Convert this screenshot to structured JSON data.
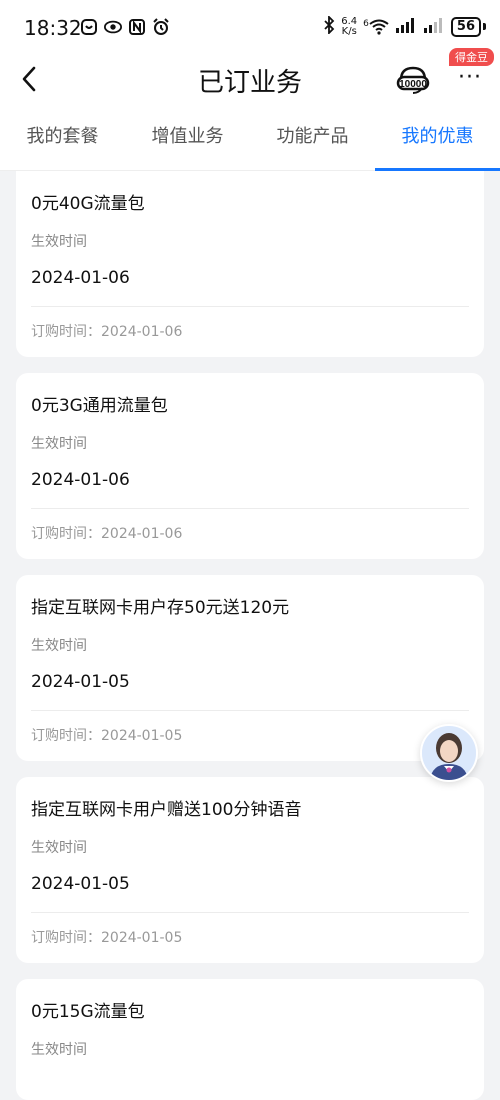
{
  "status_bar": {
    "time": "18:32",
    "net_speed_value": "6.4",
    "net_speed_unit": "K/s",
    "wifi_label": "6",
    "battery": "56"
  },
  "header": {
    "title": "已订业务",
    "reward_badge": "得金豆",
    "more_label": "···"
  },
  "tabs": [
    {
      "label": "我的套餐",
      "active": false
    },
    {
      "label": "增值业务",
      "active": false
    },
    {
      "label": "功能产品",
      "active": false
    },
    {
      "label": "我的优惠",
      "active": true
    }
  ],
  "labels": {
    "effective_time": "生效时间",
    "order_time_prefix": "订购时间："
  },
  "items": [
    {
      "name": "0元40G流量包",
      "effective_date": "2024-01-06",
      "order_date": "2024-01-06"
    },
    {
      "name": "0元3G通用流量包",
      "effective_date": "2024-01-06",
      "order_date": "2024-01-06"
    },
    {
      "name": "指定互联网卡用户存50元送120元",
      "effective_date": "2024-01-05",
      "order_date": "2024-01-05"
    },
    {
      "name": "指定互联网卡用户赠送100分钟语音",
      "effective_date": "2024-01-05",
      "order_date": "2024-01-05"
    },
    {
      "name": "0元15G流量包",
      "effective_date": "",
      "order_date": ""
    }
  ],
  "colors": {
    "accent": "#1677ff",
    "badge": "#f04d4d",
    "background": "#f2f3f5"
  }
}
